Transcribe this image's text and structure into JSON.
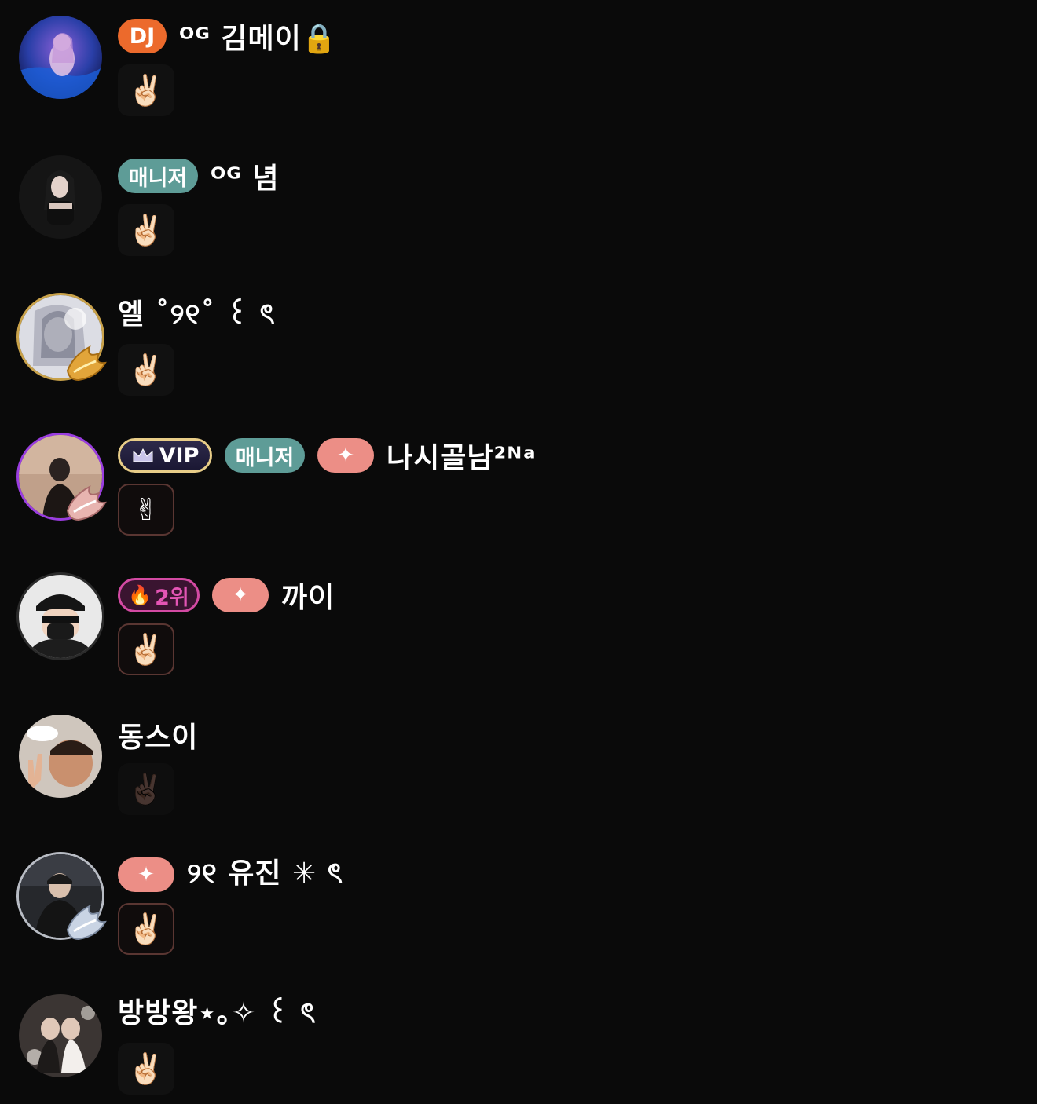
{
  "members": [
    {
      "badges": [
        {
          "type": "dj",
          "label": "DJ"
        }
      ],
      "username": "ᴼᴳ 김메이🔒",
      "reaction": "✌🏻",
      "reaction_style": "plain",
      "avatar_ring": "none",
      "avatar_deco": "none"
    },
    {
      "badges": [
        {
          "type": "manager",
          "label": "매니저"
        }
      ],
      "username": "ᴼᴳ 념",
      "reaction": "✌🏻",
      "reaction_style": "plain",
      "avatar_ring": "none",
      "avatar_deco": "none"
    },
    {
      "badges": [],
      "username": "엘 ˚୨୧˚ ꒰ ৎ",
      "reaction": "✌🏻",
      "reaction_style": "plain",
      "avatar_ring": "gold",
      "avatar_deco": "gold-wings"
    },
    {
      "badges": [
        {
          "type": "vip",
          "label": "VIP"
        },
        {
          "type": "manager",
          "label": "매니저"
        },
        {
          "type": "sparkle",
          "label": "✦"
        }
      ],
      "username": "나시골남²ᴺᵃ",
      "reaction": "✌",
      "reaction_style": "outlined",
      "avatar_ring": "purple",
      "avatar_deco": "pink-wings"
    },
    {
      "badges": [
        {
          "type": "rank",
          "label": "2위",
          "icon": "🔥"
        },
        {
          "type": "sparkle",
          "label": "✦"
        }
      ],
      "username": "까이",
      "reaction": "✌🏻",
      "reaction_style": "outlined",
      "avatar_ring": "dark",
      "avatar_deco": "none"
    },
    {
      "badges": [],
      "username": "동스이",
      "reaction": "✌🏿",
      "reaction_style": "dim",
      "avatar_ring": "none",
      "avatar_deco": "none"
    },
    {
      "badges": [
        {
          "type": "sparkle",
          "label": "✦"
        }
      ],
      "username": "୨୧ 유진 ✳ ৎ",
      "reaction": "✌🏻",
      "reaction_style": "outlined",
      "avatar_ring": "silver",
      "avatar_deco": "silver-wings"
    },
    {
      "badges": [],
      "username": "방방왕⋆｡✧ ꒰ ৎ",
      "reaction": "✌🏻",
      "reaction_style": "plain",
      "avatar_ring": "none",
      "avatar_deco": "none"
    }
  ],
  "colors": {
    "background": "#0a0a0a",
    "dj": "#ec6a2c",
    "manager": "#5e9c97",
    "sparkle": "#ec8e86",
    "vip_border": "#e8cd88",
    "rank_border": "#d34aa3"
  }
}
